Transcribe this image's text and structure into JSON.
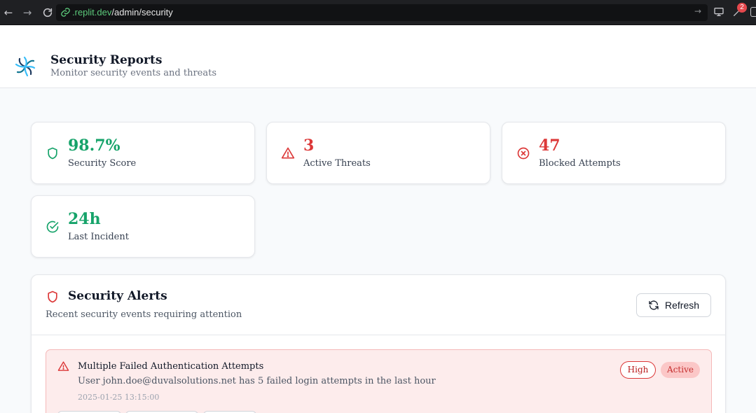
{
  "browser": {
    "url_domain": ".replit.dev",
    "url_path": "/admin/security",
    "notification_count": "2",
    "icons": [
      "back-arrow-icon",
      "forward-arrow-icon",
      "reload-icon",
      "link-icon",
      "go-arrow-icon",
      "monitor-icon",
      "tool-icon"
    ]
  },
  "header": {
    "title": "Security Reports",
    "subtitle": "Monitor security events and threats"
  },
  "stats": [
    {
      "value": "98.7%",
      "label": "Security Score",
      "icon": "shield-icon",
      "color": "#16a36a"
    },
    {
      "value": "3",
      "label": "Active Threats",
      "icon": "warning-triangle-icon",
      "color": "#dc3838"
    },
    {
      "value": "47",
      "label": "Blocked Attempts",
      "icon": "x-circle-icon",
      "color": "#dc3838"
    },
    {
      "value": "24h",
      "label": "Last Incident",
      "icon": "check-circle-icon",
      "color": "#16a36a"
    }
  ],
  "alerts": {
    "title": "Security Alerts",
    "description": "Recent security events requiring attention",
    "refresh_label": "Refresh",
    "items": [
      {
        "title": "Multiple Failed Authentication Attempts",
        "description": "User john.doe@duvalsolutions.net has 5 failed login attempts in the last hour",
        "timestamp": "2025-01-25 13:15:00",
        "severity": "High",
        "status": "Active"
      }
    ]
  },
  "colors": {
    "success": "#16a36a",
    "danger": "#dc3838",
    "alert_background": "#fdecec"
  }
}
